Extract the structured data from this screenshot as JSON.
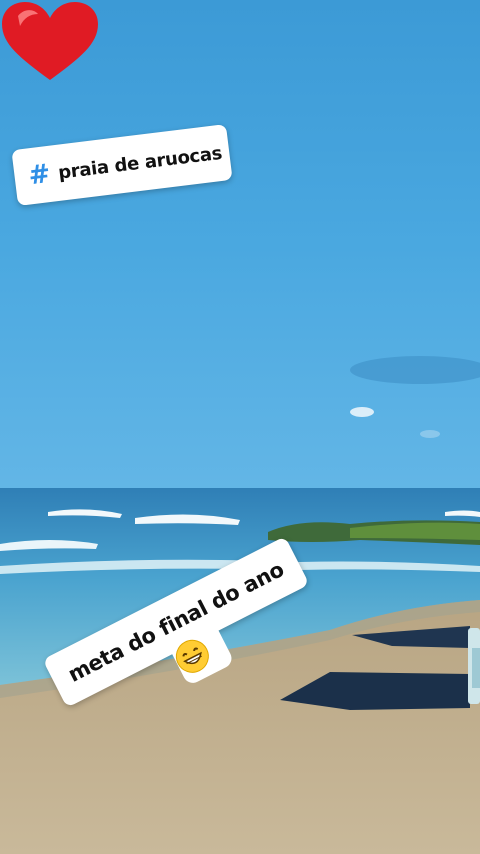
{
  "stickers": {
    "hashtag": {
      "symbol": "#",
      "text": "praia de aruocas"
    },
    "caption": {
      "text": "meta do final do ano"
    }
  },
  "icons": {
    "heart": "red-heart-emoji",
    "emoji": "grinning-face-emoji"
  },
  "colors": {
    "hashtag_symbol": "#2f8fe6",
    "heart": "#e01b24"
  }
}
